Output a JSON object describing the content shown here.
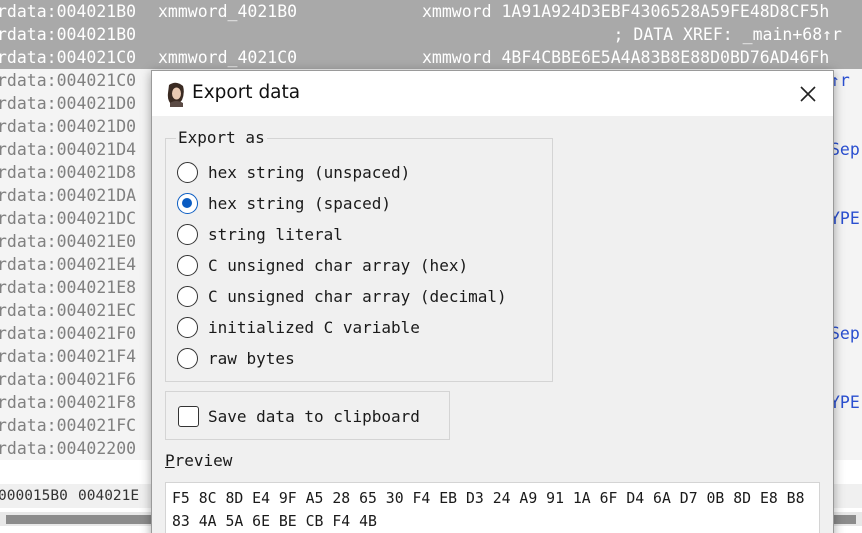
{
  "listing": {
    "rows": [
      {
        "addr": "rdata:004021B0",
        "text": "xmmword_4021B0",
        "value": "xmmword 1A91A924D3EBF4306528A59FE48D8CF5h",
        "hl": true
      },
      {
        "addr": "rdata:004021B0",
        "text": "",
        "xref": "; DATA XREF: _main+68↑r",
        "hl": true
      },
      {
        "addr": "rdata:004021C0",
        "text": "xmmword_4021C0",
        "value": "xmmword 4BF4CBBE6E5A4A83B8E88D0BD76AD46Fh",
        "hl": true
      },
      {
        "addr": "rdata:004021C0"
      },
      {
        "addr": "rdata:004021D0"
      },
      {
        "addr": "rdata:004021D0"
      },
      {
        "addr": "rdata:004021D4"
      },
      {
        "addr": "rdata:004021D8"
      },
      {
        "addr": "rdata:004021DA"
      },
      {
        "addr": "rdata:004021DC"
      },
      {
        "addr": "rdata:004021E0"
      },
      {
        "addr": "rdata:004021E4"
      },
      {
        "addr": "rdata:004021E8"
      },
      {
        "addr": "rdata:004021EC"
      },
      {
        "addr": "rdata:004021F0"
      },
      {
        "addr": "rdata:004021F4"
      },
      {
        "addr": "rdata:004021F6"
      },
      {
        "addr": "rdata:004021F8"
      },
      {
        "addr": "rdata:004021FC"
      },
      {
        "addr": "rdata:00402200"
      }
    ],
    "right_fragments": [
      "↑r",
      "Sep",
      "YPE",
      "Sep",
      "YPE"
    ],
    "status": {
      "offset": "000015B0",
      "address": "004021E"
    }
  },
  "dialog": {
    "title": "Export data",
    "close_icon": "close-icon",
    "group_label": "Export as",
    "options": [
      {
        "label": "hex string (unspaced)",
        "checked": false
      },
      {
        "label": "hex string (spaced)",
        "checked": true
      },
      {
        "label": "string literal",
        "checked": false
      },
      {
        "label": "C unsigned char array (hex)",
        "checked": false
      },
      {
        "label": "C unsigned char array (decimal)",
        "checked": false
      },
      {
        "label": "initialized C variable",
        "checked": false
      },
      {
        "label": "raw bytes",
        "checked": false
      }
    ],
    "clipboard_label": "Save data to clipboard",
    "clipboard_checked": false,
    "preview_label_first": "P",
    "preview_label_rest": "review",
    "preview_text": "F5 8C 8D E4 9F A5 28 65 30 F4 EB D3 24 A9 91 1A 6F D4 6A D7 0B 8D E8 B8 83 4A 5A 6E BE CB F4 4B",
    "colors": {
      "accent": "#0a5cc2",
      "dialog_bg": "#f0f0f0",
      "highlight": "#a9a9a9"
    }
  }
}
